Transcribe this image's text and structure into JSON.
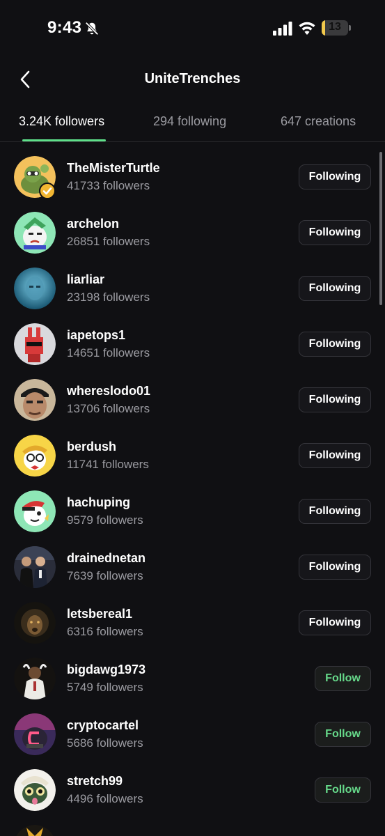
{
  "status_bar": {
    "time": "9:43",
    "battery": "13",
    "battery_level": 0.13
  },
  "header": {
    "title": "UniteTrenches"
  },
  "tabs": [
    {
      "label": "3.24K followers",
      "active": true
    },
    {
      "label": "294 following",
      "active": false
    },
    {
      "label": "647 creations",
      "active": false
    }
  ],
  "users": [
    {
      "name": "TheMisterTurtle",
      "followers": "41733 followers",
      "button": "Following",
      "verified": true
    },
    {
      "name": "archelon",
      "followers": "26851 followers",
      "button": "Following"
    },
    {
      "name": "liarliar",
      "followers": "23198 followers",
      "button": "Following"
    },
    {
      "name": "iapetops1",
      "followers": "14651 followers",
      "button": "Following"
    },
    {
      "name": "whereslodo01",
      "followers": "13706 followers",
      "button": "Following"
    },
    {
      "name": "berdush",
      "followers": "11741 followers",
      "button": "Following"
    },
    {
      "name": "hachuping",
      "followers": "9579 followers",
      "button": "Following"
    },
    {
      "name": "drainednetan",
      "followers": "7639 followers",
      "button": "Following"
    },
    {
      "name": "letsbereal1",
      "followers": "6316 followers",
      "button": "Following"
    },
    {
      "name": "bigdawg1973",
      "followers": "5749 followers",
      "button": "Follow"
    },
    {
      "name": "cryptocartel",
      "followers": "5686 followers",
      "button": "Follow"
    },
    {
      "name": "stretch99",
      "followers": "4496 followers",
      "button": "Follow"
    },
    {
      "name": "",
      "followers": "",
      "button": ""
    }
  ],
  "colors": {
    "accent": "#5fe08a",
    "follow_text": "#66d98a",
    "background": "#101013",
    "muted_text": "#9b9ba1"
  },
  "icons": {
    "back": "chevron-left-icon",
    "bell": "bell-slash-icon",
    "signal": "signal-icon",
    "wifi": "wifi-icon",
    "verified": "verified-check-icon"
  }
}
